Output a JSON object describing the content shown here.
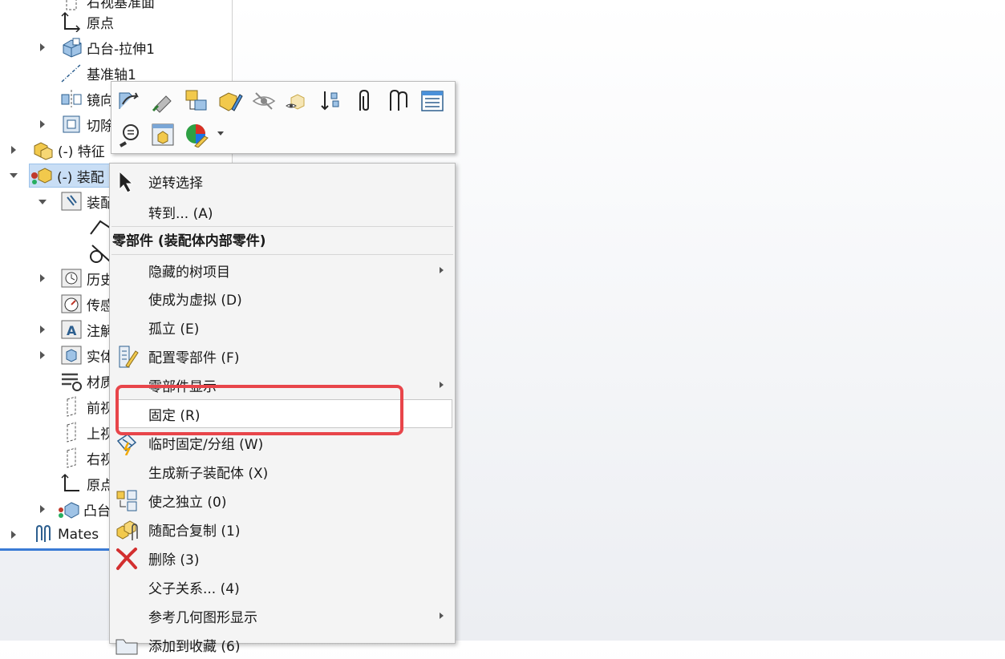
{
  "tree": {
    "items": [
      {
        "label": "右视基准面"
      },
      {
        "label": "原点"
      },
      {
        "label": "凸台-拉伸1"
      },
      {
        "label": "基准轴1"
      },
      {
        "label": "镜向"
      },
      {
        "label": "切除"
      },
      {
        "label": "(-) 特征"
      },
      {
        "label": "(-) 装配"
      },
      {
        "label": "装配"
      },
      {
        "label": "历史"
      },
      {
        "label": "传感"
      },
      {
        "label": "注解"
      },
      {
        "label": "实体"
      },
      {
        "label": "材质"
      },
      {
        "label": "前视"
      },
      {
        "label": "上视"
      },
      {
        "label": "右视"
      },
      {
        "label": "原点"
      },
      {
        "label": "凸台"
      },
      {
        "label": "Mates"
      }
    ]
  },
  "toolbar": {
    "icons": [
      "open-part-icon",
      "edit-part-icon",
      "smartmate-icon",
      "edit-sketch-icon",
      "hide-icon",
      "isolate-icon",
      "rebuild-icon",
      "mate-icon",
      "mate-reference-icon",
      "properties-list-icon",
      "zoom-to-selection-icon",
      "component-properties-icon",
      "appearance-icon"
    ]
  },
  "menu": {
    "items": {
      "invert_select": "逆转选择",
      "goto": "转到... (A)",
      "section_header": "零部件 (装配体内部零件)",
      "hidden_tree": "隐藏的树项目",
      "make_virtual": "使成为虚拟 (D)",
      "isolate": "孤立 (E)",
      "configure": "配置零部件 (F)",
      "component_display": "零部件显示",
      "fix": "固定 (R)",
      "temp_fix": "临时固定/分组 (W)",
      "new_subassembly": "生成新子装配体 (X)",
      "make_independent": "使之独立 (0)",
      "copy_with_mates": "随配合复制 (1)",
      "delete": "删除 (3)",
      "parent_child": "父子关系... (4)",
      "ref_geometry": "参考几何图形显示",
      "add_to_favorites": "添加到收藏 (6)"
    }
  },
  "colors": {
    "highlight": "#e8454a",
    "selection": "#c9def5",
    "accent": "#3a7bd5"
  }
}
